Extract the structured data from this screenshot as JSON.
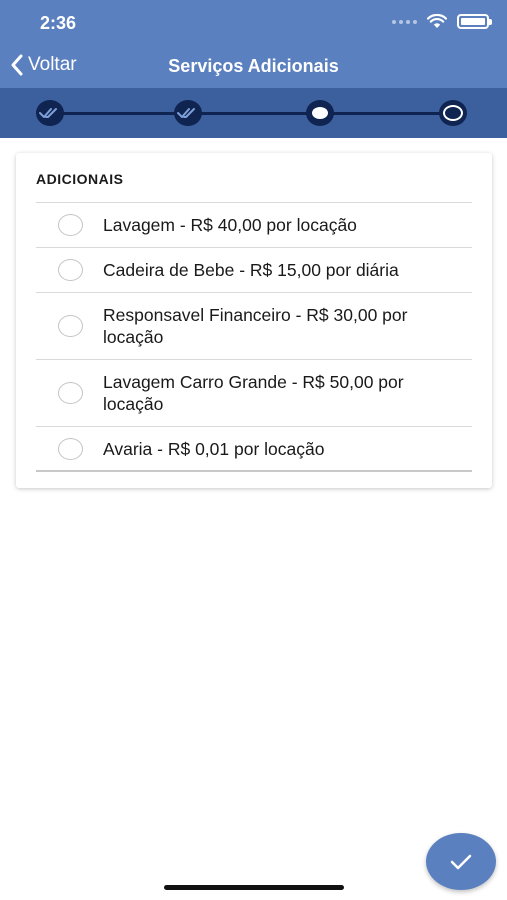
{
  "status_bar": {
    "time": "2:36"
  },
  "nav": {
    "back_label": "Voltar",
    "title": "Serviços Adicionais"
  },
  "stepper": {
    "steps": [
      "done",
      "done",
      "current",
      "upcoming"
    ],
    "current_step": 3,
    "total_steps": 4
  },
  "section": {
    "title": "ADICIONAIS"
  },
  "options": [
    {
      "label": "Lavagem - R$ 40,00 por locação",
      "selected": false
    },
    {
      "label": "Cadeira de Bebe - R$ 15,00 por diária",
      "selected": false
    },
    {
      "label": "Responsavel Financeiro - R$ 30,00 por locação",
      "selected": false
    },
    {
      "label": "Lavagem Carro Grande - R$ 50,00 por locação",
      "selected": false
    },
    {
      "label": "Avaria - R$ 0,01 por locação",
      "selected": false
    }
  ],
  "colors": {
    "header": "#5b80bf",
    "stepper_bar": "#3c5f9e",
    "stepper_dark": "#0f2450",
    "fab": "#5b80bf"
  }
}
